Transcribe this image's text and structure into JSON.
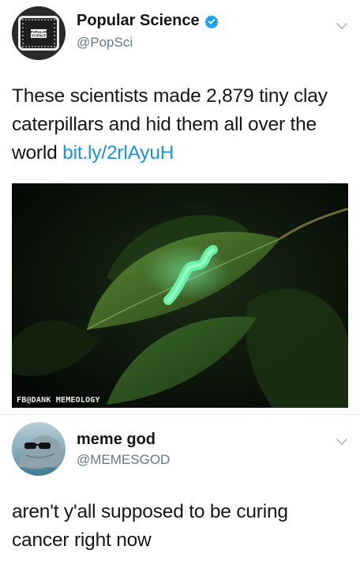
{
  "tweet1": {
    "author": {
      "name": "Popular Science",
      "handle": "@PopSci",
      "verified": true,
      "avatar_icon": "popsci-logo",
      "avatar_text": "POPULAR SCIENCE"
    },
    "text_before_link": "These scientists made 2,879 tiny clay caterpillars and hid them all over the world ",
    "link": "bit.ly/2rlAyuH",
    "menu_icon": "chevron-down-icon",
    "media": {
      "description": "green clay caterpillar on a leaf at night",
      "watermark": "FB@DANK MEMEOLOGY"
    }
  },
  "tweet2": {
    "author": {
      "name": "meme god",
      "handle": "@MEMESGOD",
      "avatar_icon": "dolphin-sunglasses-avatar"
    },
    "text": "aren't y'all supposed to be curing cancer right now",
    "menu_icon": "chevron-down-icon"
  },
  "colors": {
    "link": "#1b95e0",
    "verified": "#1da1f2",
    "secondary_text": "#657786",
    "chevron": "#aab8c2"
  }
}
